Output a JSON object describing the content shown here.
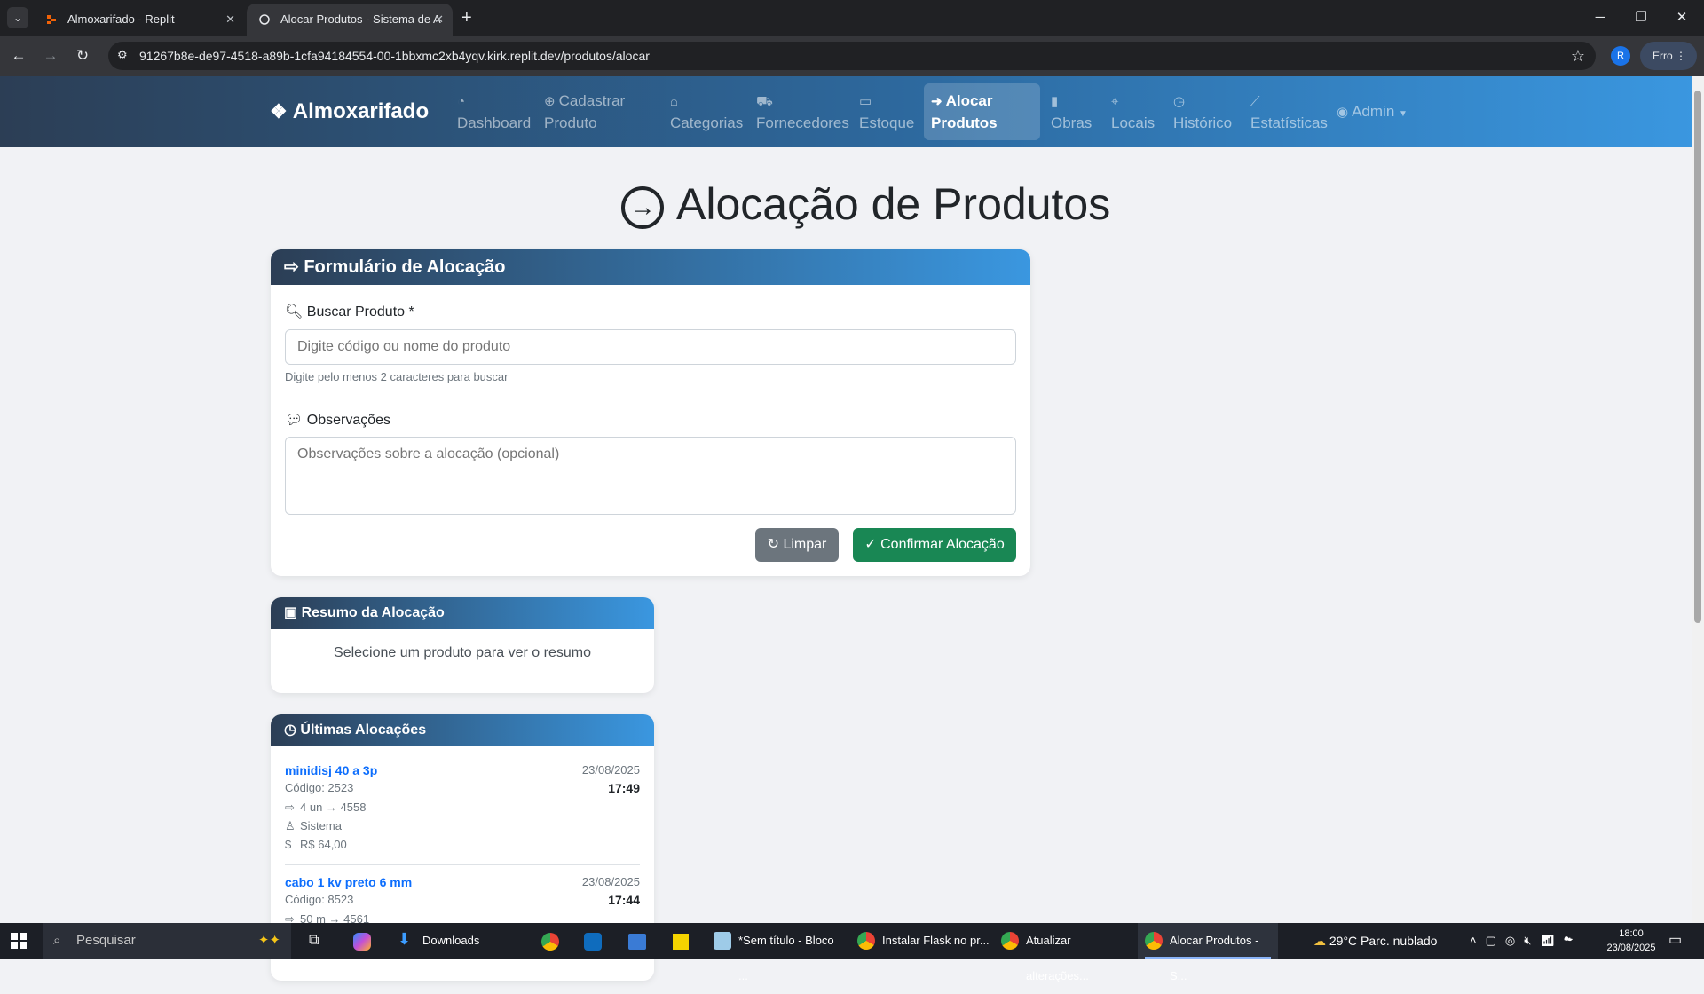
{
  "browser": {
    "tabs": [
      {
        "title": "Almoxarifado - Replit"
      },
      {
        "title": "Alocar Produtos - Sistema de A"
      }
    ],
    "url": "91267b8e-de97-4518-a89b-1cfa94184554-00-1bbxmc2xb4yqv.kirk.replit.dev/produtos/alocar",
    "profile_initial": "R",
    "error_label": "Erro"
  },
  "nav": {
    "brand": "Almoxarifado",
    "items": [
      {
        "label": "Dashboard",
        "icon": "gauge-icon"
      },
      {
        "label": "Cadastrar Produto",
        "icon": "plus-circle-icon"
      },
      {
        "label": "Categorias",
        "icon": "tag-icon"
      },
      {
        "label": "Fornecedores",
        "icon": "truck-icon"
      },
      {
        "label": "Estoque",
        "icon": "box-icon"
      },
      {
        "label": "Alocar Produtos",
        "icon": "arrow-circle-icon"
      },
      {
        "label": "Obras",
        "icon": "building-icon"
      },
      {
        "label": "Locais",
        "icon": "pin-icon"
      },
      {
        "label": "Histórico",
        "icon": "clock-icon"
      },
      {
        "label": "Estatísticas",
        "icon": "chart-icon"
      },
      {
        "label": "Admin",
        "icon": "user-icon"
      }
    ]
  },
  "page_title": "Alocação de Produtos",
  "form": {
    "title": "Formulário de Alocação",
    "search_label": "Buscar Produto *",
    "search_placeholder": "Digite código ou nome do produto",
    "search_help": "Digite pelo menos 2 caracteres para buscar",
    "obs_label": "Observações",
    "obs_placeholder": "Observações sobre a alocação (opcional)",
    "clear_label": "Limpar",
    "confirm_label": "Confirmar Alocação"
  },
  "summary": {
    "title": "Resumo da Alocação",
    "empty_text": "Selecione um produto para ver o resumo"
  },
  "last": {
    "title": "Últimas Alocações",
    "items": [
      {
        "name": "minidisj 40 a 3p",
        "code": "Código: 2523",
        "date": "23/08/2025",
        "time": "17:49",
        "qty": "4 un → 4558",
        "user": "Sistema",
        "value": "R$ 64,00"
      },
      {
        "name": "cabo 1 kv preto 6 mm",
        "code": "Código: 8523",
        "date": "23/08/2025",
        "time": "17:44",
        "qty": "50 m → 4561",
        "user": "",
        "value": ""
      }
    ]
  },
  "taskbar": {
    "search": "Pesquisar",
    "downloads": "Downloads",
    "tasks": [
      "*Sem título - Bloco ...",
      "Instalar Flask no pr...",
      "Atualizar alterações...",
      "Alocar Produtos - S..."
    ],
    "weather": "29°C  Parc. nublado",
    "time": "18:00",
    "date": "23/08/2025"
  }
}
